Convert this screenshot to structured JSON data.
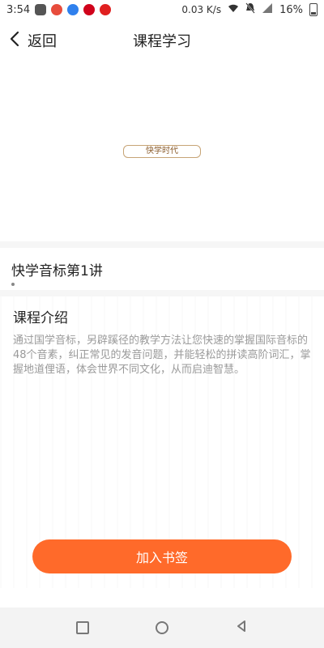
{
  "status_bar": {
    "time": "3:54",
    "network_speed": "0.03 K/s",
    "battery_percent": "16%"
  },
  "header": {
    "back_label": "返回",
    "title": "课程学习"
  },
  "banner": {
    "brand_label": "快学时代"
  },
  "lesson": {
    "title": "快学音标第1讲"
  },
  "intro": {
    "title": "课程介绍",
    "description": "通过国学音标，另辟蹊径的教学方法让您快速的掌握国际音标的48个音素，纠正常见的发音问题，并能轻松的拼读高阶词汇，掌握地道俚语，体会世界不同文化，从而启迪智慧。"
  },
  "actions": {
    "add_bookmark_label": "加入书签"
  },
  "colors": {
    "accent": "#ff6a2a",
    "brand_border": "#c7a476",
    "brand_text": "#8a5b2b"
  }
}
